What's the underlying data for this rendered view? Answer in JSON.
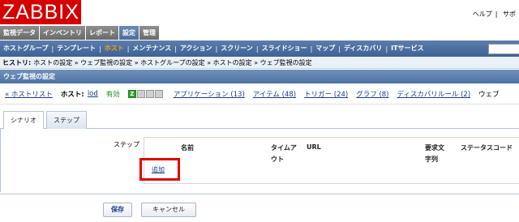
{
  "logo": "ZABBIX",
  "toplinks": {
    "help": "ヘルプ",
    "sep": "|",
    "support": "サポ"
  },
  "mainmenu": [
    "監視データ",
    "インベントリ",
    "レポート",
    "設定",
    "管理"
  ],
  "submenu": {
    "items": [
      "ホストグループ",
      "テンプレート",
      "ホスト",
      "メンテナンス",
      "アクション",
      "スクリーン",
      "スライドショー",
      "マップ",
      "ディスカバリ",
      "ITサービス"
    ],
    "sep": "|"
  },
  "history": {
    "label": "ヒストリ:",
    "path": "ホストの設定 » ウェブ監視の設定 » ホストグループの設定 » ホストの設定 » ウェブ監視の設定"
  },
  "page_title": "ウェブ監視の設定",
  "hostbar": {
    "host_list": "« ホストリスト",
    "host_label": "ホスト:",
    "host_name": "lod",
    "status": "有効",
    "availability": [
      "Z",
      "",
      "",
      ""
    ],
    "applications": "アプリケーション (13)",
    "items": "アイテム (48)",
    "triggers": "トリガー (24)",
    "graphs": "グラフ (8)",
    "discovery": "ディスカバリルール (2)",
    "web": "ウェブ"
  },
  "tabs": [
    "シナリオ",
    "ステップ"
  ],
  "steps": {
    "label": "ステップ",
    "columns": {
      "name": "名前",
      "timeout_1": "タイムア",
      "timeout_2": "ウト",
      "url": "URL",
      "required_1": "要求文",
      "required_2": "字列",
      "status": "ステータスコード"
    },
    "add": "追加"
  },
  "buttons": {
    "save": "保存",
    "cancel": "キャンセル"
  }
}
